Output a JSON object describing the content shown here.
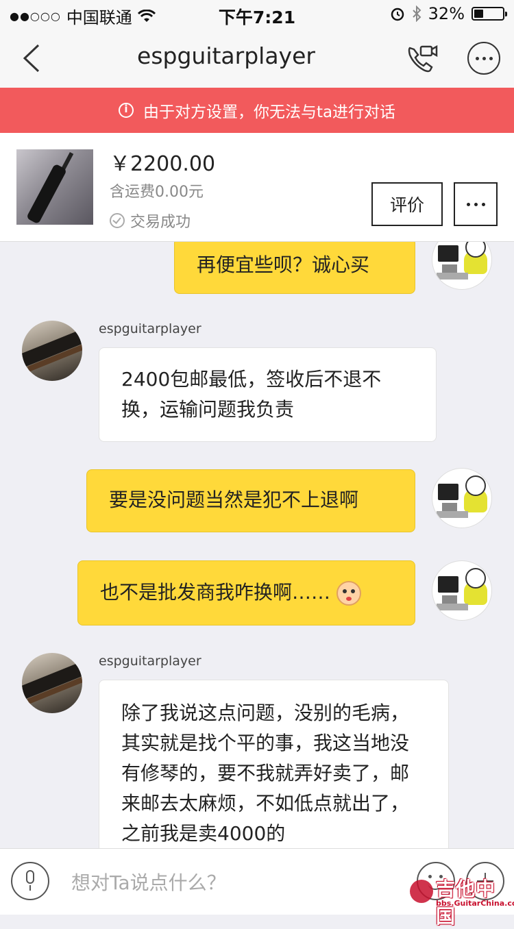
{
  "status_bar": {
    "signal": "●●○○○",
    "carrier": "中国联通",
    "time": "下午7:21",
    "battery_percent": "32%",
    "battery_level": 0.32
  },
  "nav": {
    "title": "espguitarplayer"
  },
  "banner": {
    "text": "由于对方设置，你无法与ta进行对话",
    "color": "#f25a5c"
  },
  "product": {
    "price": "￥2200.00",
    "shipping": "含运费0.00元",
    "status": "交易成功",
    "rate_label": "评价"
  },
  "messages": [
    {
      "from": "me",
      "text": "再便宜些呗？诚心买"
    },
    {
      "from": "them",
      "sender": "espguitarplayer",
      "text": "2400包邮最低，签收后不退不换，运输问题我负责"
    },
    {
      "from": "me",
      "text": "要是没问题当然是犯不上退啊"
    },
    {
      "from": "me",
      "text": "也不是批发商我咋换啊……",
      "emoji": "flushed-sweat-emoji"
    },
    {
      "from": "them",
      "sender": "espguitarplayer",
      "text": "除了我说这点问题，没别的毛病，其实就是找个平的事，我这当地没有修琴的，要不我就弄好卖了，邮来邮去太麻烦，不如低点就出了，之前我是卖4000的"
    }
  ],
  "input_bar": {
    "placeholder": "想对Ta说点什么？"
  },
  "watermark": {
    "title": "吉他中国",
    "url": "bbs.GuitarChina.com"
  },
  "colors": {
    "my_bubble": "#ffd93a",
    "their_bubble": "#ffffff",
    "background": "#efeff4"
  }
}
